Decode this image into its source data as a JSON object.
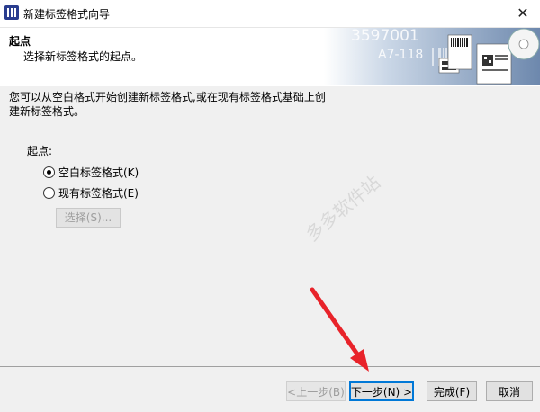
{
  "window": {
    "title": "新建标签格式向导",
    "close_glyph": "✕"
  },
  "header": {
    "title": "起点",
    "subtitle": "选择新标签格式的起点。",
    "banner_texts": [
      "3597001",
      "A7-118"
    ]
  },
  "content": {
    "description": "您可以从空白格式开始创建新标签格式,或在现有标签格式基础上创建新标签格式。",
    "start_label": "起点:",
    "options": [
      {
        "label": "空白标签格式(K)",
        "checked": true
      },
      {
        "label": "现有标签格式(E)",
        "checked": false
      }
    ],
    "select_button": "选择(S)..."
  },
  "footer": {
    "back": "<上一步(B)",
    "next": "下一步(N) >",
    "finish": "完成(F)",
    "cancel": "取消"
  },
  "colors": {
    "arrow": "#e8232a",
    "accent": "#0078d7",
    "panel": "#f0f0f0"
  }
}
